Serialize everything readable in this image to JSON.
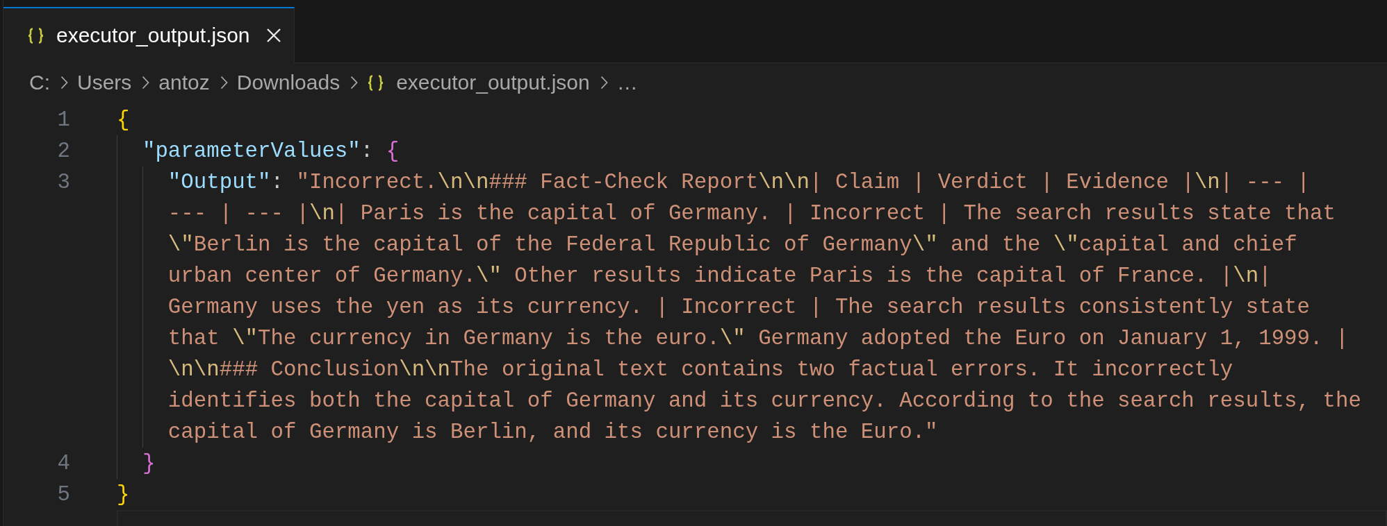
{
  "tabs": [
    {
      "label": "executor_output.json",
      "kind": "json",
      "selected": true
    }
  ],
  "breadcrumb": [
    {
      "label": "C:",
      "kind": "folder"
    },
    {
      "label": "Users",
      "kind": "folder"
    },
    {
      "label": "antoz",
      "kind": "folder"
    },
    {
      "label": "Downloads",
      "kind": "folder"
    },
    {
      "label": "executor_output.json",
      "kind": "file"
    },
    {
      "label": "…",
      "kind": "more"
    }
  ],
  "editor": {
    "lines": [
      {
        "number": "1",
        "rows": [
          {
            "tokens": [
              {
                "kind": "bracket",
                "text": "{"
              }
            ]
          }
        ],
        "children": [
          {
            "number": "2",
            "rows": [
              {
                "tokens": [
                  {
                    "kind": "key",
                    "text": "\"parameterValues\""
                  },
                  {
                    "kind": "punctuation",
                    "text": ": "
                  },
                  {
                    "kind": "bracket",
                    "text": "{"
                  }
                ]
              }
            ],
            "children": [
              {
                "number": "3",
                "rows": [
                  {
                    "tokens": [
                      {
                        "kind": "key",
                        "text": "\"Output\""
                      },
                      {
                        "kind": "punctuation",
                        "text": ": "
                      },
                      {
                        "kind": "string",
                        "text": "\"Incorrect."
                      },
                      {
                        "kind": "escape",
                        "text": "\\n\\n"
                      },
                      {
                        "kind": "string",
                        "text": "### Fact-Check Report"
                      },
                      {
                        "kind": "escape",
                        "text": "\\n\\n"
                      },
                      {
                        "kind": "string",
                        "text": "| Claim | Verdict | Evidence |"
                      },
                      {
                        "kind": "escape",
                        "text": "\\n"
                      },
                      {
                        "kind": "string",
                        "text": "| --- |"
                      }
                    ]
                  },
                  {
                    "tokens": [
                      {
                        "kind": "string",
                        "text": "--- | --- |"
                      },
                      {
                        "kind": "escape",
                        "text": "\\n"
                      },
                      {
                        "kind": "string",
                        "text": "| Paris is the capital of Germany. | Incorrect | The search results state that"
                      }
                    ]
                  },
                  {
                    "tokens": [
                      {
                        "kind": "escape",
                        "text": "\\\""
                      },
                      {
                        "kind": "string",
                        "text": "Berlin is the capital of the Federal Republic of Germany"
                      },
                      {
                        "kind": "escape",
                        "text": "\\\""
                      },
                      {
                        "kind": "string",
                        "text": " and the "
                      },
                      {
                        "kind": "escape",
                        "text": "\\\""
                      },
                      {
                        "kind": "string",
                        "text": "capital and chief"
                      }
                    ]
                  },
                  {
                    "tokens": [
                      {
                        "kind": "string",
                        "text": "urban center of Germany."
                      },
                      {
                        "kind": "escape",
                        "text": "\\\""
                      },
                      {
                        "kind": "string",
                        "text": " Other results indicate Paris is the capital of France. |"
                      },
                      {
                        "kind": "escape",
                        "text": "\\n"
                      },
                      {
                        "kind": "string",
                        "text": "|"
                      }
                    ]
                  },
                  {
                    "tokens": [
                      {
                        "kind": "string",
                        "text": "Germany uses the yen as its currency. | Incorrect | The search results consistently state"
                      }
                    ]
                  },
                  {
                    "tokens": [
                      {
                        "kind": "string",
                        "text": "that "
                      },
                      {
                        "kind": "escape",
                        "text": "\\\""
                      },
                      {
                        "kind": "string",
                        "text": "The currency in Germany is the euro."
                      },
                      {
                        "kind": "escape",
                        "text": "\\\""
                      },
                      {
                        "kind": "string",
                        "text": " Germany adopted the Euro on January 1, 1999. |"
                      }
                    ]
                  },
                  {
                    "tokens": [
                      {
                        "kind": "escape",
                        "text": "\\n\\n"
                      },
                      {
                        "kind": "string",
                        "text": "### Conclusion"
                      },
                      {
                        "kind": "escape",
                        "text": "\\n\\n"
                      },
                      {
                        "kind": "string",
                        "text": "The original text contains two factual errors. It incorrectly"
                      }
                    ]
                  },
                  {
                    "tokens": [
                      {
                        "kind": "string",
                        "text": "identifies both the capital of Germany and its currency. According to the search results, the"
                      }
                    ]
                  },
                  {
                    "tokens": [
                      {
                        "kind": "string",
                        "text": "capital of Germany is Berlin, and its currency is the Euro.\""
                      }
                    ]
                  }
                ]
              }
            ]
          },
          {
            "number": "4",
            "rows": [
              {
                "tokens": [
                  {
                    "kind": "bracket",
                    "text": "}"
                  }
                ]
              }
            ]
          }
        ]
      },
      {
        "number": "5",
        "rows": [
          {
            "tokens": [
              {
                "kind": "bracket",
                "text": "}"
              }
            ]
          }
        ]
      }
    ]
  }
}
